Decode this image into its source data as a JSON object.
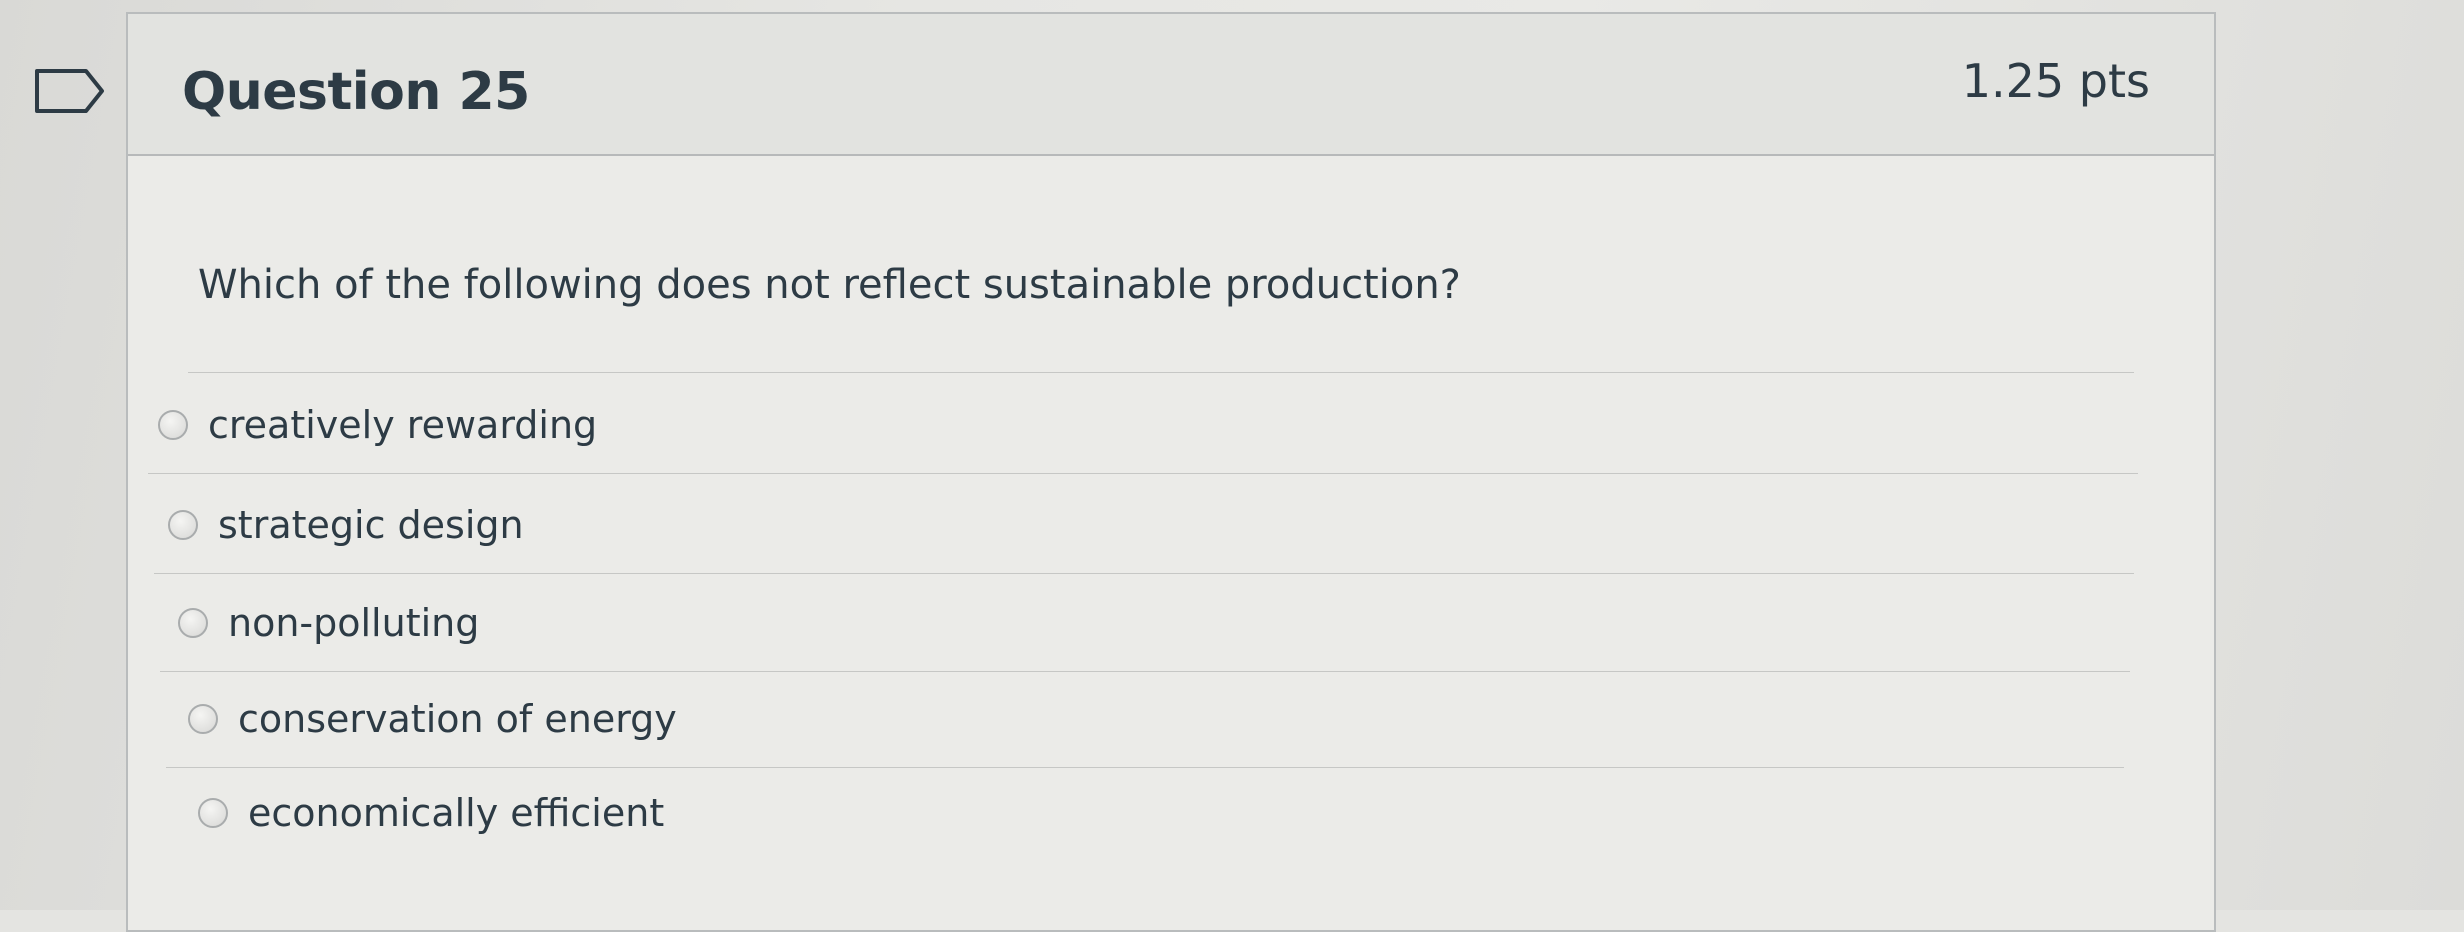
{
  "question": {
    "title": "Question 25",
    "points": "1.25 pts",
    "text": "Which of the following does not reflect sustainable production?",
    "flag_icon": "flag-outline-icon",
    "answers": [
      {
        "label": "creatively rewarding",
        "selected": false
      },
      {
        "label": "strategic design",
        "selected": false
      },
      {
        "label": "non-polluting",
        "selected": false
      },
      {
        "label": "conservation of energy",
        "selected": false
      },
      {
        "label": "economically efficient",
        "selected": false
      }
    ]
  },
  "colors": {
    "text": "#2d3b45",
    "header_bg": "#e2e3e0",
    "border": "#b7b9ba"
  }
}
